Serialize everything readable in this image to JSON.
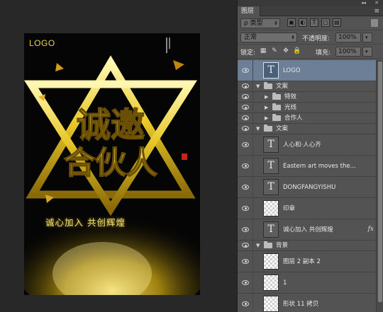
{
  "poster": {
    "logo_text": "LOGO",
    "title_line1": "诚邀",
    "title_line2": "合伙人",
    "tagline": "诚心加入 共创辉煌"
  },
  "panel": {
    "tab_label": "图层",
    "filter": {
      "label": "ρ 类型",
      "icons": [
        "image-filter-icon",
        "adjustment-filter-icon",
        "type-filter-icon",
        "shape-filter-icon",
        "smart-object-filter-icon"
      ]
    },
    "blend_mode": "正常",
    "opacity_label": "不透明度:",
    "opacity_value": "100%",
    "lock_label": "锁定:",
    "fill_label": "填充:",
    "fill_value": "100%"
  },
  "layers": [
    {
      "kind": "text",
      "name": "LOGO",
      "selected": true,
      "indent": 0
    },
    {
      "kind": "group",
      "name": "文案",
      "expanded": true,
      "indent": 0
    },
    {
      "kind": "group",
      "name": "特效",
      "expanded": false,
      "indent": 1
    },
    {
      "kind": "group",
      "name": "光线",
      "expanded": false,
      "indent": 1
    },
    {
      "kind": "group",
      "name": "合作人",
      "expanded": false,
      "indent": 1
    },
    {
      "kind": "group",
      "name": "文案",
      "expanded": true,
      "indent": 0
    },
    {
      "kind": "text",
      "name": "人心和·人心齐",
      "indent": 1
    },
    {
      "kind": "text",
      "name": "Eastern art moves the...",
      "indent": 1
    },
    {
      "kind": "text",
      "name": "DONGFANGYISHU",
      "indent": 1
    },
    {
      "kind": "raster",
      "name": "印章",
      "indent": 1
    },
    {
      "kind": "text",
      "name": "诚心加入 共创辉煌",
      "indent": 1,
      "fx": "fx"
    },
    {
      "kind": "group",
      "name": "背景",
      "expanded": true,
      "indent": 0
    },
    {
      "kind": "raster",
      "name": "图层 2 副本 2",
      "indent": 1
    },
    {
      "kind": "raster",
      "name": "1",
      "indent": 1
    },
    {
      "kind": "raster",
      "name": "形状 11 拷贝",
      "indent": 1
    }
  ],
  "colors": {
    "panel_bg": "#535353",
    "selected_row": "#6c7f96",
    "gold": "#e9d54e"
  }
}
